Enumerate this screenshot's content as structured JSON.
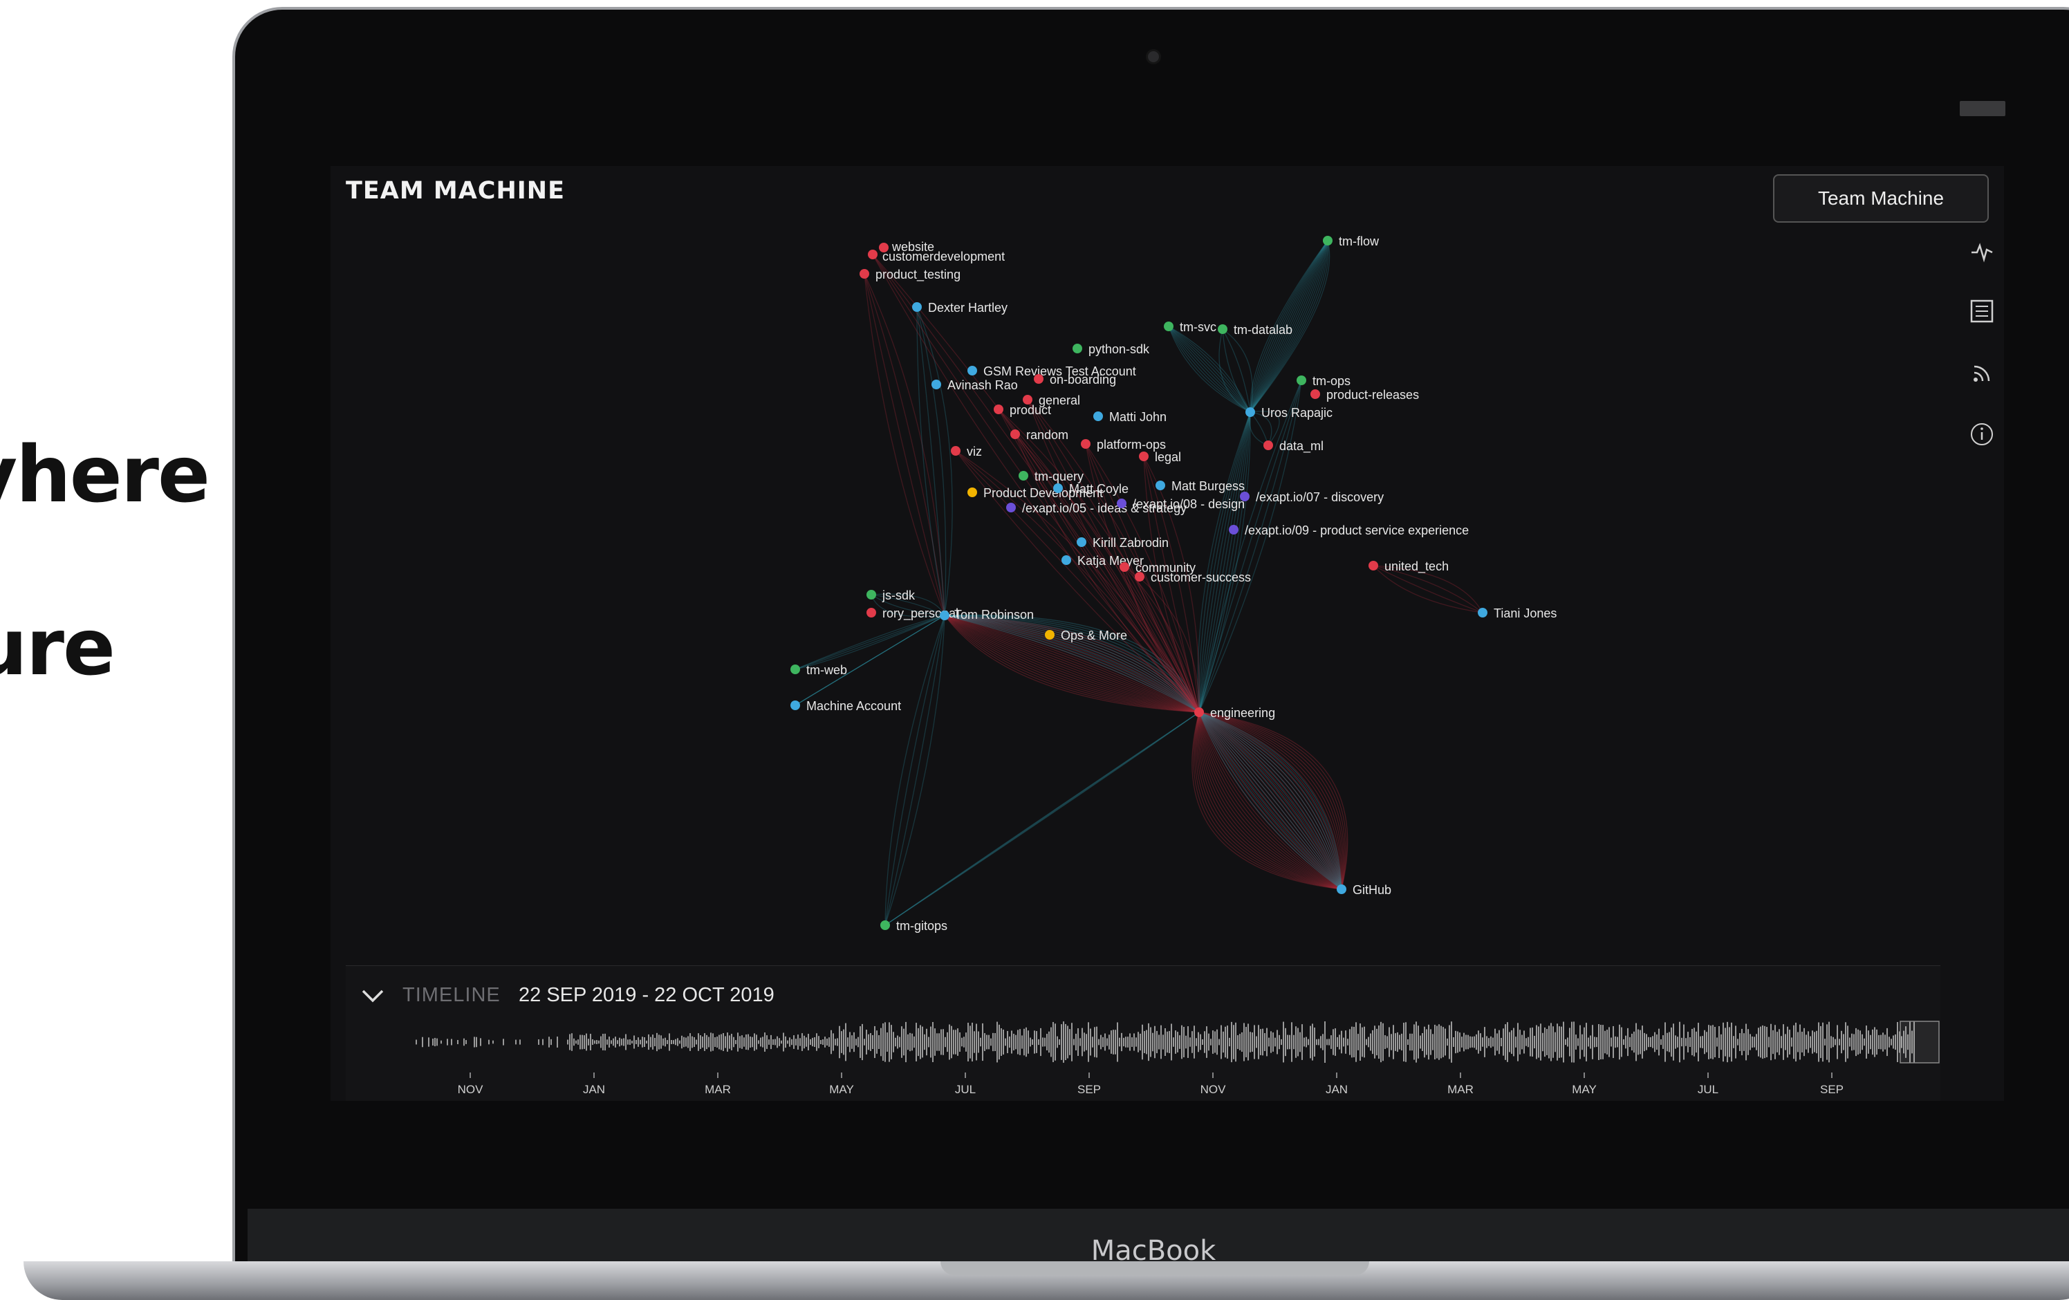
{
  "hero": {
    "line1": "vhere",
    "line2": "ure"
  },
  "laptop": {
    "brand": "MacBook"
  },
  "app": {
    "title": "TEAM MACHINE",
    "top_button": "Team Machine",
    "side_icons": [
      "activity-icon",
      "list-icon",
      "rss-icon",
      "info-icon"
    ]
  },
  "colors": {
    "slack_channel": "#e23b4a",
    "person": "#3fa9e0",
    "repo": "#3eb55f",
    "workspace": "#f2b400",
    "project": "#6b4fd8",
    "edge_red": "#b02a3a",
    "edge_teal": "#2a8a9a"
  },
  "nodes": [
    {
      "label": "website",
      "kind": "slack_channel"
    },
    {
      "label": "customerdevelopment",
      "kind": "slack_channel"
    },
    {
      "label": "product_testing",
      "kind": "slack_channel"
    },
    {
      "label": "tm-flow",
      "kind": "repo"
    },
    {
      "label": "Dexter Hartley",
      "kind": "person"
    },
    {
      "label": "tm-svc",
      "kind": "repo"
    },
    {
      "label": "tm-datalab",
      "kind": "repo"
    },
    {
      "label": "python-sdk",
      "kind": "repo"
    },
    {
      "label": "GSM Reviews Test Account",
      "kind": "person"
    },
    {
      "label": "on-boarding",
      "kind": "slack_channel"
    },
    {
      "label": "Avinash Rao",
      "kind": "person"
    },
    {
      "label": "tm-ops",
      "kind": "repo"
    },
    {
      "label": "product-releases",
      "kind": "slack_channel"
    },
    {
      "label": "general",
      "kind": "slack_channel"
    },
    {
      "label": "product",
      "kind": "slack_channel"
    },
    {
      "label": "Matti John",
      "kind": "person"
    },
    {
      "label": "Uros Rapajic",
      "kind": "person"
    },
    {
      "label": "random",
      "kind": "slack_channel"
    },
    {
      "label": "platform-ops",
      "kind": "slack_channel"
    },
    {
      "label": "data_ml",
      "kind": "slack_channel"
    },
    {
      "label": "viz",
      "kind": "slack_channel"
    },
    {
      "label": "legal",
      "kind": "slack_channel"
    },
    {
      "label": "tm-query",
      "kind": "repo"
    },
    {
      "label": "Product Development",
      "kind": "workspace"
    },
    {
      "label": "Matt Coyle",
      "kind": "person"
    },
    {
      "label": "Matt Burgess",
      "kind": "person"
    },
    {
      "label": "/exapt.io/05 - ideas & strategy",
      "kind": "project"
    },
    {
      "label": "/exapt.io/08 - design",
      "kind": "project"
    },
    {
      "label": "/exapt.io/07 - discovery",
      "kind": "project"
    },
    {
      "label": "/exapt.io/09 - product service experience",
      "kind": "project"
    },
    {
      "label": "Kirill Zabrodin",
      "kind": "person"
    },
    {
      "label": "Katja Meyer",
      "kind": "person"
    },
    {
      "label": "community",
      "kind": "slack_channel"
    },
    {
      "label": "customer-success",
      "kind": "slack_channel"
    },
    {
      "label": "united_tech",
      "kind": "slack_channel"
    },
    {
      "label": "js-sdk",
      "kind": "repo"
    },
    {
      "label": "rory_personal",
      "kind": "slack_channel"
    },
    {
      "label": "Tom Robinson",
      "kind": "person"
    },
    {
      "label": "Tiani Jones",
      "kind": "person"
    },
    {
      "label": "Ops & More",
      "kind": "workspace"
    },
    {
      "label": "tm-web",
      "kind": "repo"
    },
    {
      "label": "Machine Account",
      "kind": "person"
    },
    {
      "label": "engineering",
      "kind": "slack_channel"
    },
    {
      "label": "GitHub",
      "kind": "person"
    },
    {
      "label": "tm-gitops",
      "kind": "repo"
    }
  ],
  "timeline": {
    "label": "TIMELINE",
    "range": "22 SEP 2019 - 22 OCT 2019",
    "months": [
      "NOV",
      "JAN",
      "MAR",
      "MAY",
      "JUL",
      "SEP",
      "NOV",
      "JAN",
      "MAR",
      "MAY",
      "JUL",
      "SEP"
    ]
  }
}
